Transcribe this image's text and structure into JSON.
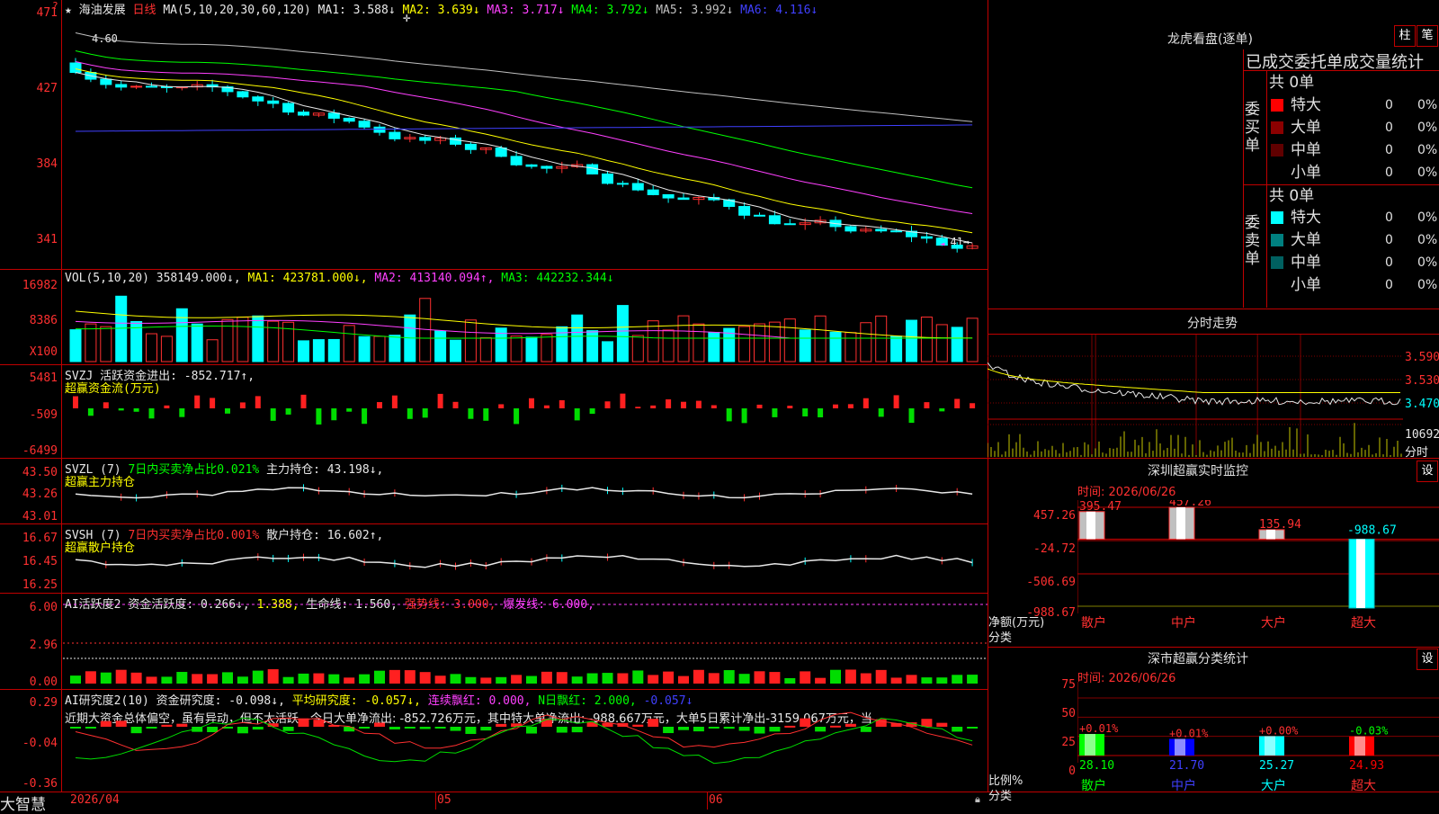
{
  "app": {
    "name": "大智慧",
    "date_label": "2026/04"
  },
  "stock": {
    "name": "海油发展",
    "period": "日线"
  },
  "price_panel": {
    "ma_label": "MA(5,10,20,30,60,120)",
    "ma": [
      {
        "label": "MA1:",
        "value": "3.588",
        "arrow": "↓",
        "color": "#e8e8e8"
      },
      {
        "label": "MA2:",
        "value": "3.639",
        "arrow": "↓",
        "color": "#ffff00"
      },
      {
        "label": "MA3:",
        "value": "3.717",
        "arrow": "↓",
        "color": "#ff40ff"
      },
      {
        "label": "MA4:",
        "value": "3.792",
        "arrow": "↓",
        "color": "#00ff00"
      },
      {
        "label": "MA5:",
        "value": "3.992",
        "arrow": "↓",
        "color": "#c0c0c0"
      },
      {
        "label": "MA6:",
        "value": "4.116",
        "arrow": "↓",
        "color": "#4040ff"
      }
    ],
    "yticks": [
      "471",
      "427",
      "384",
      "341"
    ],
    "high_label": "4.60",
    "low_label": "3.41→"
  },
  "vol_panel": {
    "title": "VOL(5,10,20)",
    "value": "358149.000↓,",
    "ma1": "MA1: 423781.000↓,",
    "ma2": "MA2: 413140.094↑,",
    "ma3": "MA3: 442232.344↓",
    "yticks": [
      "16982",
      "8386",
      "X100"
    ]
  },
  "svzj_panel": {
    "title": "SVZJ",
    "text": "活跃资金进出: -852.717↑,",
    "sub": "超赢资金流(万元)",
    "yticks": [
      "5481",
      "-509",
      "-6499"
    ]
  },
  "svzl_panel": {
    "title": "SVZL (7)",
    "ratio": "7日内买卖净占比0.021%",
    "hold": "主力持仓: 43.198↓,",
    "sub": "超赢主力持仓",
    "yticks": [
      "43.50",
      "43.26",
      "43.01"
    ]
  },
  "svsh_panel": {
    "title": "SVSH (7)",
    "ratio": "7日内买卖净占比0.001%",
    "hold": "散户持仓: 16.602↑,",
    "sub": "超赢散户持仓",
    "yticks": [
      "16.67",
      "16.45",
      "16.25"
    ]
  },
  "ai_active_panel": {
    "title": "AI活跃度2",
    "text1": "资金活跃度: 0.266↓,",
    "text2": "1.388,",
    "text3": "生命线: 1.560,",
    "text4": "强势线: 3.000,",
    "text5": "爆发线: 6.000,",
    "yticks": [
      "6.00",
      "2.96",
      "0.00"
    ]
  },
  "ai_research_panel": {
    "title": "AI研究度2(10)",
    "text1": "资金研究度: -0.098↓,",
    "text2": "平均研究度: -0.057↓,",
    "text3": "连续飘红: 0.000,",
    "text4": "N日飘红: 2.000,",
    "text5": "-0.057↓",
    "summary": "近期大资金总体偏空，虽有异动，但不太活跃，今日大单净流出: -852.726万元，其中特大单净流出: -988.667万元，大单5日累计净出-3159.067万元，当",
    "yticks": [
      "0.29",
      "-0.04",
      "-0.36"
    ]
  },
  "x_axis": {
    "labels": [
      "05",
      "06"
    ]
  },
  "longhu": {
    "title": "龙虎看盘(逐单)",
    "btn1": "柱",
    "btn2": "笔",
    "subtitle": "已成交委托单成交量统计",
    "buy": {
      "side_label": "委买单",
      "total": "共 0单",
      "rows": [
        {
          "label": "特大",
          "count": "0",
          "pct": "0%",
          "color": "#ff0000"
        },
        {
          "label": "大单",
          "count": "0",
          "pct": "0%",
          "color": "#8b0000"
        },
        {
          "label": "中单",
          "count": "0",
          "pct": "0%",
          "color": "#600000"
        },
        {
          "label": "小单",
          "count": "0",
          "pct": "0%",
          "color": ""
        }
      ]
    },
    "sell": {
      "side_label": "委卖单",
      "total": "共 0单",
      "rows": [
        {
          "label": "特大",
          "count": "0",
          "pct": "0%",
          "color": "#00ffff"
        },
        {
          "label": "大单",
          "count": "0",
          "pct": "0%",
          "color": "#008080"
        },
        {
          "label": "中单",
          "count": "0",
          "pct": "0%",
          "color": "#006060"
        },
        {
          "label": "小单",
          "count": "0",
          "pct": "0%",
          "color": ""
        }
      ]
    }
  },
  "intraday": {
    "title": "分时走势",
    "yticks": [
      "3.590",
      "3.530",
      "3.470",
      "10692",
      "分时"
    ]
  },
  "monitor": {
    "title": "深圳超赢实时监控",
    "btn": "设",
    "time": "时间: 2026/06/26",
    "yticks": [
      "457.26",
      "-24.72",
      "-506.69",
      "-988.67"
    ],
    "ylabel1": "净额(万元)",
    "ylabel2": "分类",
    "bars": [
      {
        "name": "散户",
        "value": 395.47,
        "label": "395.47"
      },
      {
        "name": "中户",
        "value": 457.26,
        "label": "457.26"
      },
      {
        "name": "大户",
        "value": 135.94,
        "label": "135.94"
      },
      {
        "name": "超大",
        "value": -988.67,
        "label": "-988.67"
      }
    ]
  },
  "classify": {
    "title": "深市超赢分类统计",
    "btn": "设",
    "time": "时间: 2026/06/26",
    "yticks": [
      "75",
      "50",
      "25",
      "0"
    ],
    "ylabel1": "比例%",
    "ylabel2": "分类",
    "bars": [
      {
        "name": "散户",
        "value": 28.1,
        "label": "28.10",
        "change": "+0.01%",
        "color": "#00ff00"
      },
      {
        "name": "中户",
        "value": 21.7,
        "label": "21.70",
        "change": "+0.01%",
        "color": "#0000ff"
      },
      {
        "name": "大户",
        "value": 25.27,
        "label": "25.27",
        "change": "+0.00%",
        "color": "#00ffff"
      },
      {
        "name": "超大",
        "value": 24.93,
        "label": "24.93",
        "change": "-0.03%",
        "color": "#ff0000"
      }
    ]
  }
}
